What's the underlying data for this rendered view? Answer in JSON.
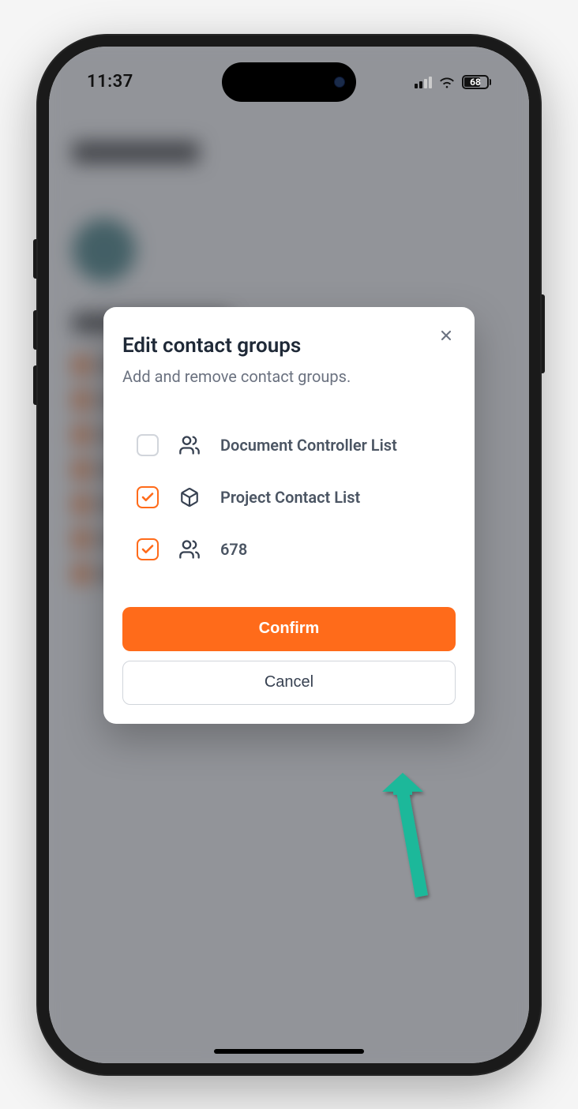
{
  "status_bar": {
    "time": "11:37",
    "battery_percent": "68"
  },
  "modal": {
    "title": "Edit contact groups",
    "subtitle": "Add and remove contact groups.",
    "groups": [
      {
        "label": "Document Controller List",
        "checked": false,
        "icon": "users"
      },
      {
        "label": "Project Contact List",
        "checked": true,
        "icon": "cube"
      },
      {
        "label": "678",
        "checked": true,
        "icon": "users"
      }
    ],
    "confirm_label": "Confirm",
    "cancel_label": "Cancel"
  },
  "colors": {
    "accent": "#ff6b1a",
    "arrow": "#1fb89a"
  }
}
